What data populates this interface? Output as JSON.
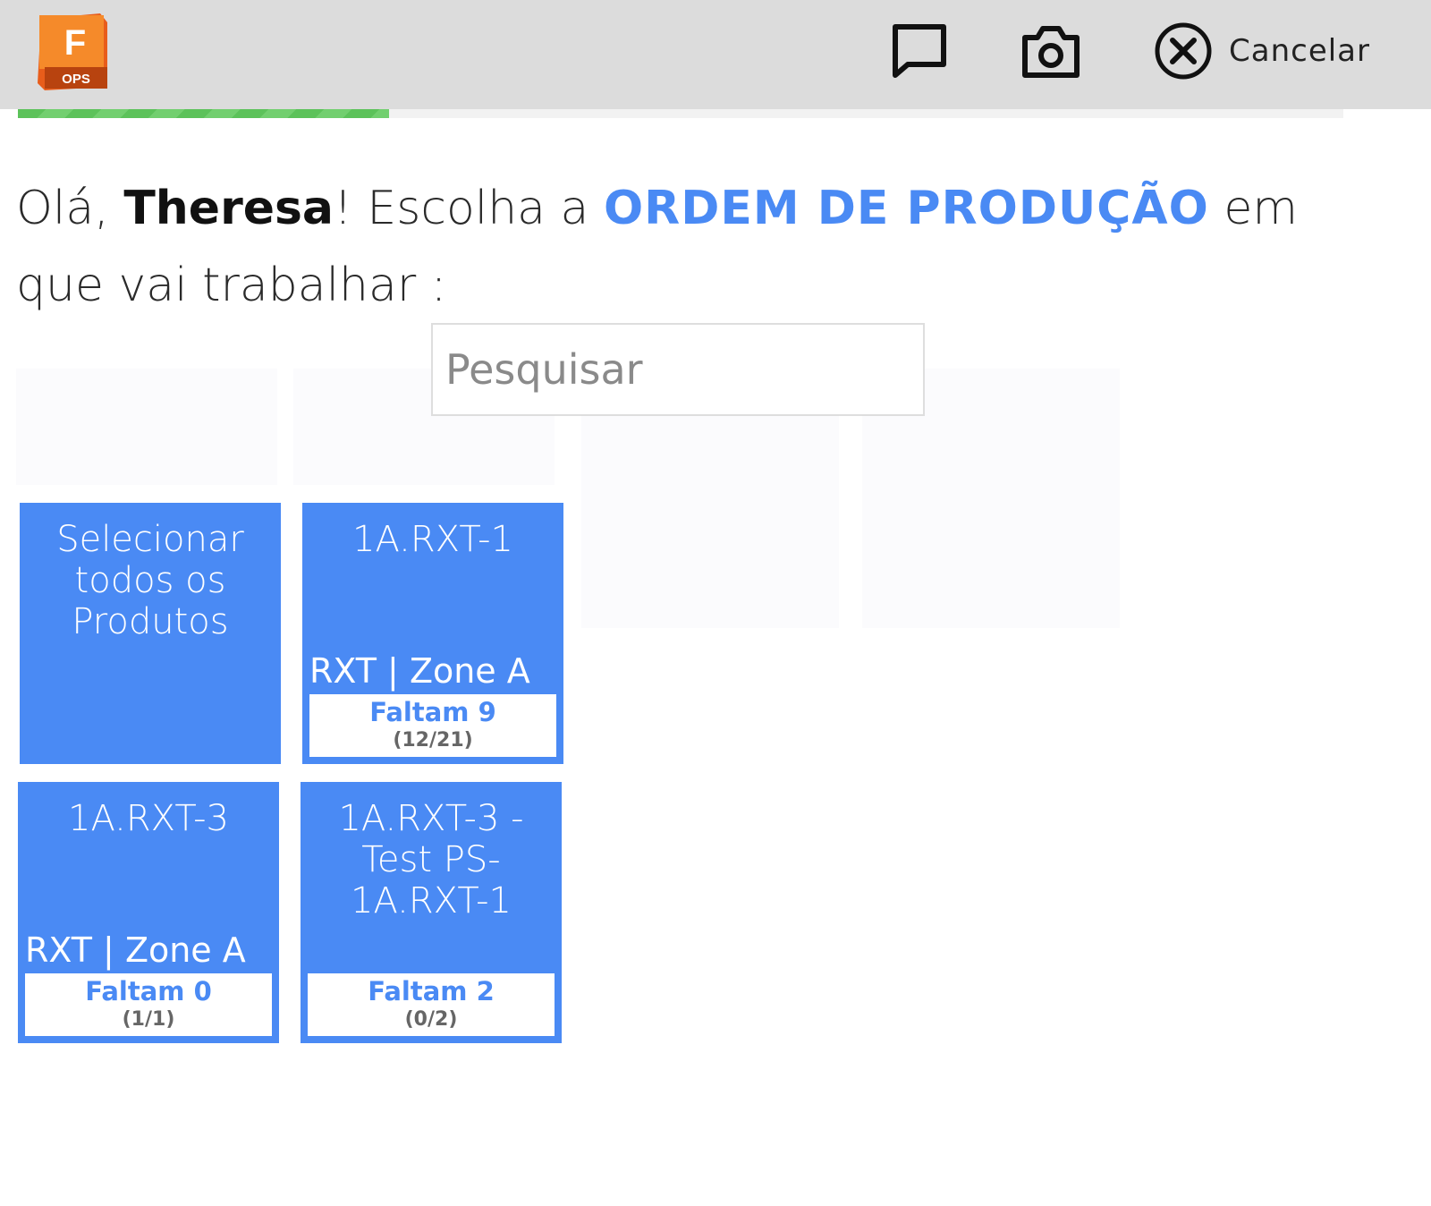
{
  "header": {
    "logo_letter": "F",
    "logo_sub": "OPS",
    "message_icon": "message-icon",
    "camera_icon": "camera-icon",
    "cancel_icon": "close-circle-icon",
    "cancel_label": "Cancelar"
  },
  "progress": {
    "percent": 28,
    "color": "#5cc25a"
  },
  "greeting": {
    "prefix": "Olá, ",
    "name": "Theresa",
    "middle": "! Escolha a ",
    "highlight": "ORDEM DE PRODUÇÃO",
    "suffix": " em que vai trabalhar :"
  },
  "search": {
    "placeholder": "Pesquisar",
    "value": ""
  },
  "tiles": [
    {
      "title": "Selecionar todos os Produtos",
      "zone": "",
      "remaining": "",
      "progress": ""
    },
    {
      "title": "1A.RXT-1",
      "zone": "RXT | Zone A",
      "remaining": "Faltam 9",
      "progress": "(12/21)"
    },
    {
      "title": "1A.RXT-3",
      "zone": "RXT | Zone A",
      "remaining": "Faltam 0",
      "progress": "(1/1)"
    },
    {
      "title": "1A.RXT-3 - Test PS-1A.RXT-1",
      "zone": "",
      "remaining": "Faltam 2",
      "progress": "(0/2)"
    }
  ],
  "colors": {
    "accent": "#4a8af4",
    "header_bg": "#dcdcdc",
    "logo_orange": "#f47b20"
  }
}
